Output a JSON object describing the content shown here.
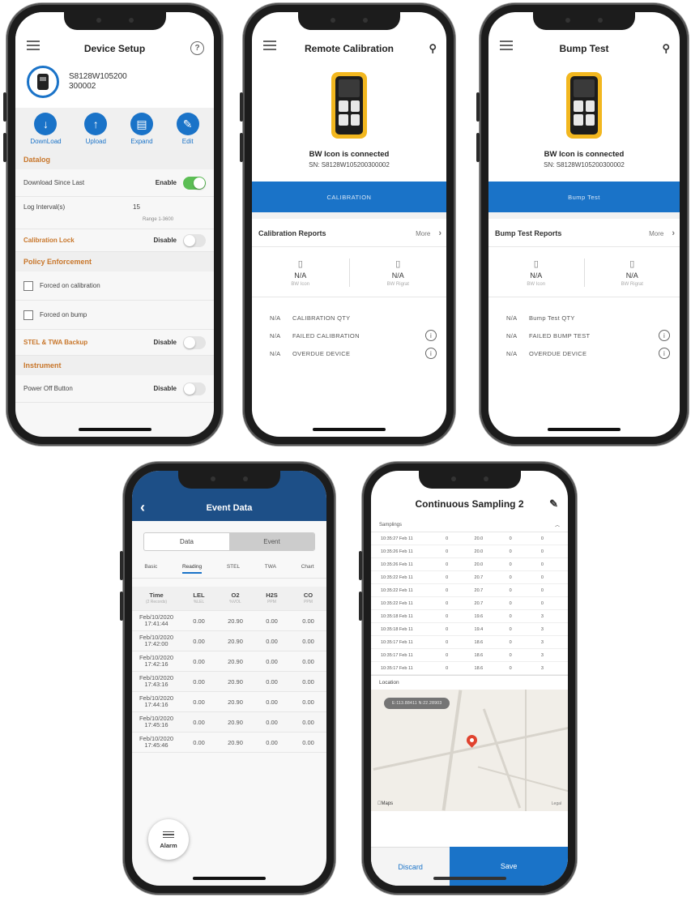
{
  "device_setup": {
    "title": "Device Setup",
    "help_glyph": "?",
    "serial_line1": "S8128W105200",
    "serial_line2": "300002",
    "actions": [
      {
        "label": "DownLoad",
        "glyph": "↓"
      },
      {
        "label": "Upload",
        "glyph": "↑"
      },
      {
        "label": "Expand",
        "glyph": "▤"
      },
      {
        "label": "Edit",
        "glyph": "✎"
      }
    ],
    "datalog_header": "Datalog",
    "download_since_last_label": "Download Since Last",
    "download_since_last_value": "Enable",
    "log_interval_label": "Log Interval(s)",
    "log_interval_value": "15",
    "log_interval_range": "Range 1-3600",
    "calibration_lock_label": "Calibration Lock",
    "calibration_lock_value": "Disable",
    "policy_header": "Policy Enforcement",
    "forced_calibration_label": "Forced on calibration",
    "forced_bump_label": "Forced on bump",
    "stel_label": "STEL & TWA Backup",
    "stel_value": "Disable",
    "instrument_header": "Instrument",
    "power_off_label": "Power Off Button",
    "power_off_value": "Disable"
  },
  "remote_calibration": {
    "title": "Remote Calibration",
    "connected": "BW Icon is connected",
    "sn": "SN: S8128W105200300002",
    "button": "CALIBRATION",
    "reports_label": "Calibration Reports",
    "more": "More",
    "left": {
      "value": "N/A",
      "sub": "BW Icon"
    },
    "right": {
      "value": "N/A",
      "sub": "BW Rigrat"
    },
    "rows": [
      {
        "n": "N/A",
        "t": "CALIBRATION QTY"
      },
      {
        "n": "N/A",
        "t": "FAILED CALIBRATION"
      },
      {
        "n": "N/A",
        "t": "OVERDUE DEVICE"
      }
    ]
  },
  "bump_test": {
    "title": "Bump Test",
    "connected": "BW Icon is connected",
    "sn": "SN: S8128W105200300002",
    "button": "Bump Test",
    "reports_label": "Bump Test Reports",
    "more": "More",
    "left": {
      "value": "N/A",
      "sub": "BW Icon"
    },
    "right": {
      "value": "N/A",
      "sub": "BW Rigrat"
    },
    "rows": [
      {
        "n": "N/A",
        "t": "Bump Test QTY"
      },
      {
        "n": "N/A",
        "t": "FAILED BUMP TEST"
      },
      {
        "n": "N/A",
        "t": "OVERDUE DEVICE"
      }
    ]
  },
  "event_data": {
    "title": "Event Data",
    "seg_data": "Data",
    "seg_event": "Event",
    "tabs": [
      "Basic",
      "Reading",
      "STEL",
      "TWA",
      "Chart"
    ],
    "headers": [
      {
        "t": "Time",
        "u": "(2 Records)"
      },
      {
        "t": "LEL",
        "u": "%LEL"
      },
      {
        "t": "O2",
        "u": "%VOL"
      },
      {
        "t": "H2S",
        "u": "PPM"
      },
      {
        "t": "CO",
        "u": "PPM"
      }
    ],
    "rows": [
      {
        "d": "Feb/10/2020",
        "tm": "17:41:44",
        "lel": "0.00",
        "o2": "20.90",
        "h2s": "0.00",
        "co": "0.00"
      },
      {
        "d": "Feb/10/2020",
        "tm": "17:42:00",
        "lel": "0.00",
        "o2": "20.90",
        "h2s": "0.00",
        "co": "0.00"
      },
      {
        "d": "Feb/10/2020",
        "tm": "17:42:16",
        "lel": "0.00",
        "o2": "20.90",
        "h2s": "0.00",
        "co": "0.00"
      },
      {
        "d": "Feb/10/2020",
        "tm": "17:43:16",
        "lel": "0.00",
        "o2": "20.90",
        "h2s": "0.00",
        "co": "0.00"
      },
      {
        "d": "Feb/10/2020",
        "tm": "17:44:16",
        "lel": "0.00",
        "o2": "20.90",
        "h2s": "0.00",
        "co": "0.00"
      },
      {
        "d": "Feb/10/2020",
        "tm": "17:45:16",
        "lel": "0.00",
        "o2": "20.90",
        "h2s": "0.00",
        "co": "0.00"
      },
      {
        "d": "Feb/10/2020",
        "tm": "17:45:46",
        "lel": "0.00",
        "o2": "20.90",
        "h2s": "0.00",
        "co": "0.00"
      }
    ],
    "alarm": "Alarm"
  },
  "continuous_sampling": {
    "title": "Continuous Sampling 2",
    "samplings_label": "Samplings",
    "rows": [
      {
        "t": "10:35:27 Feb 11",
        "a": "0",
        "b": "20.0",
        "c": "0",
        "d": "0"
      },
      {
        "t": "10:35:26 Feb 11",
        "a": "0",
        "b": "20.0",
        "c": "0",
        "d": "0"
      },
      {
        "t": "10:35:26 Feb 11",
        "a": "0",
        "b": "20.0",
        "c": "0",
        "d": "0"
      },
      {
        "t": "10:35:22 Feb 11",
        "a": "0",
        "b": "20.7",
        "c": "0",
        "d": "0"
      },
      {
        "t": "10:35:22 Feb 11",
        "a": "0",
        "b": "20.7",
        "c": "0",
        "d": "0"
      },
      {
        "t": "10:35:22 Feb 11",
        "a": "0",
        "b": "20.7",
        "c": "0",
        "d": "0"
      },
      {
        "t": "10:35:18 Feb 11",
        "a": "0",
        "b": "19.6",
        "c": "0",
        "d": "3"
      },
      {
        "t": "10:35:18 Feb 11",
        "a": "0",
        "b": "19.4",
        "c": "0",
        "d": "3"
      },
      {
        "t": "10:35:17 Feb 11",
        "a": "0",
        "b": "18.6",
        "c": "0",
        "d": "3"
      },
      {
        "t": "10:35:17 Feb 11",
        "a": "0",
        "b": "18.6",
        "c": "0",
        "d": "3"
      },
      {
        "t": "10:35:17 Feb 11",
        "a": "0",
        "b": "18.6",
        "c": "0",
        "d": "3"
      }
    ],
    "location_label": "Location",
    "coords_text": "E:113.88411     N:22.28903",
    "maps_label": "Maps",
    "legal_label": "Legal",
    "discard": "Discard",
    "save": "Save"
  }
}
